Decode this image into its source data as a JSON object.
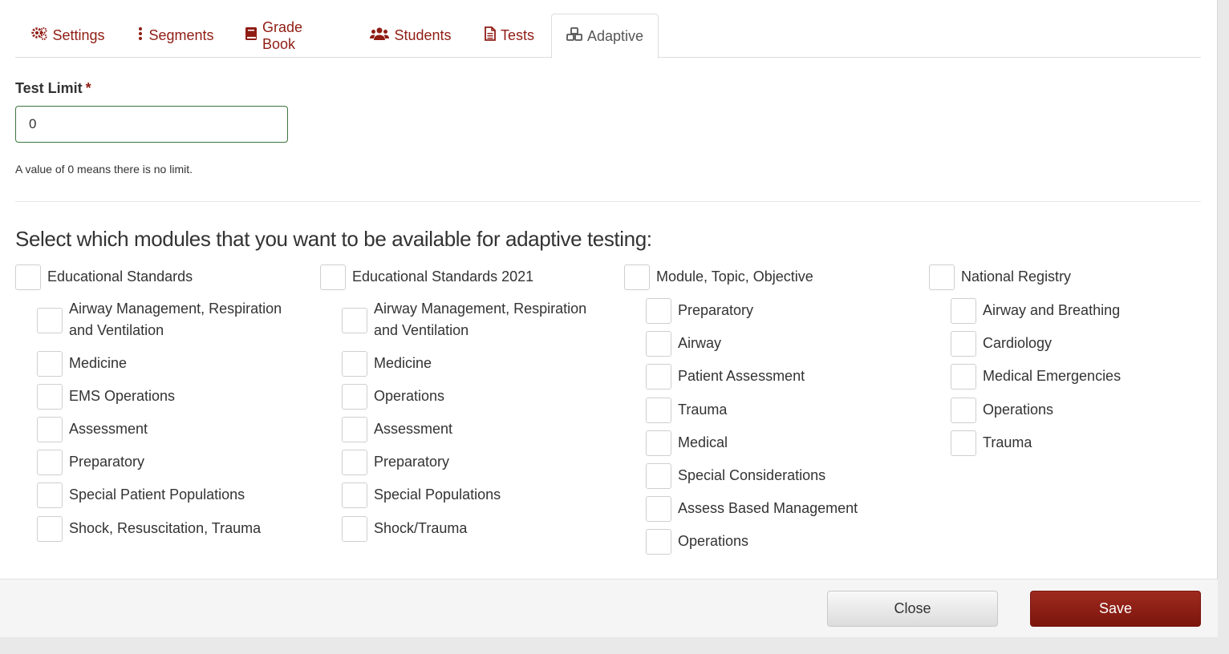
{
  "tabs": [
    {
      "label": "Settings",
      "icon": "gears-icon"
    },
    {
      "label": "Segments",
      "icon": "vertical-ellipsis-icon"
    },
    {
      "label": "Grade Book",
      "icon": "book-icon"
    },
    {
      "label": "Students",
      "icon": "users-icon"
    },
    {
      "label": "Tests",
      "icon": "file-text-icon"
    },
    {
      "label": "Adaptive",
      "icon": "cubes-icon",
      "active": true
    }
  ],
  "test_limit": {
    "label": "Test Limit",
    "required_mark": "*",
    "value": "0",
    "help": "A value of 0 means there is no limit."
  },
  "modules_heading": "Select which modules that you want to be available for adaptive testing:",
  "modules": [
    {
      "title": "Educational Standards",
      "items": [
        "Airway Management, Respiration and Ventilation",
        "Medicine",
        "EMS Operations",
        "Assessment",
        "Preparatory",
        "Special Patient Populations",
        "Shock, Resuscitation, Trauma"
      ]
    },
    {
      "title": "Educational Standards 2021",
      "items": [
        "Airway Management, Respiration and Ventilation",
        "Medicine",
        "Operations",
        "Assessment",
        "Preparatory",
        "Special Populations",
        "Shock/Trauma"
      ]
    },
    {
      "title": "Module, Topic, Objective",
      "items": [
        "Preparatory",
        "Airway",
        "Patient Assessment",
        "Trauma",
        "Medical",
        "Special Considerations",
        "Assess Based Management",
        "Operations"
      ]
    },
    {
      "title": "National Registry",
      "items": [
        "Airway and Breathing",
        "Cardiology",
        "Medical Emergencies",
        "Operations",
        "Trauma"
      ]
    }
  ],
  "footer": {
    "close_label": "Close",
    "save_label": "Save"
  },
  "colors": {
    "brand": "#8f1d14",
    "save_button": "#8f1f15",
    "input_border": "#3c763d"
  }
}
